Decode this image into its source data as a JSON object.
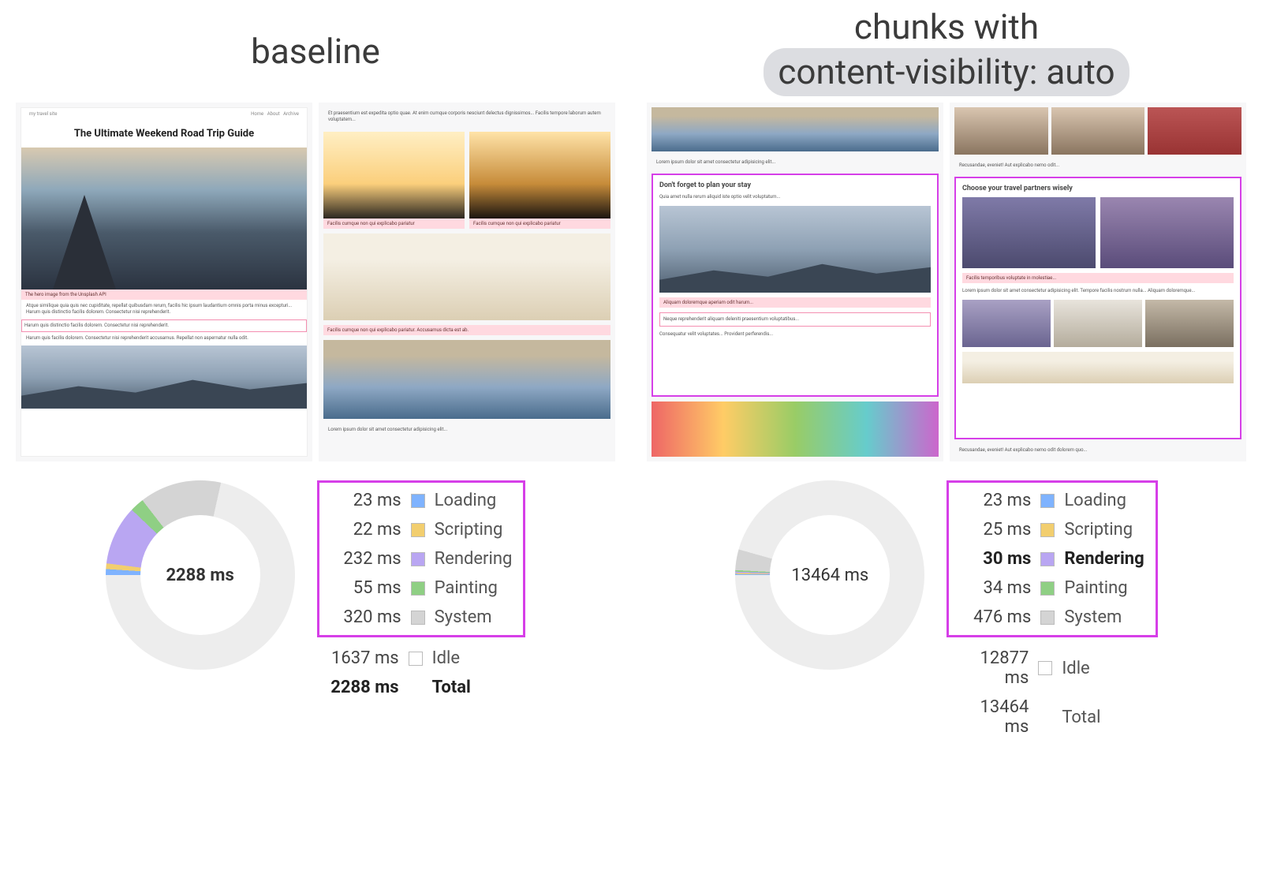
{
  "titles": {
    "left": "baseline",
    "right_line1": "chunks with",
    "right_line2_pill": "content-visibility: auto"
  },
  "mock": {
    "left_page_title": "The Ultimate Weekend Road Trip Guide",
    "section_plan_stay": "Don't forget to plan your stay",
    "section_partners": "Choose your travel partners wisely"
  },
  "legend_labels": {
    "loading": "Loading",
    "scripting": "Scripting",
    "rendering": "Rendering",
    "painting": "Painting",
    "system": "System",
    "idle": "Idle",
    "total": "Total"
  },
  "colors": {
    "loading": "#7fb3ff",
    "scripting": "#f2ce6f",
    "rendering": "#b9a6f2",
    "painting": "#8fcf84",
    "system": "#d4d4d4",
    "idle": "#ffffff",
    "highlight_border": "#d63fe8"
  },
  "left": {
    "total_center": "2288 ms",
    "rows": {
      "loading": "23 ms",
      "scripting": "22 ms",
      "rendering": "232 ms",
      "painting": "55 ms",
      "system": "320 ms",
      "idle": "1637 ms",
      "total": "2288 ms"
    }
  },
  "right": {
    "total_center": "13464 ms",
    "rows": {
      "loading": "23 ms",
      "scripting": "25 ms",
      "rendering": "30 ms",
      "painting": "34 ms",
      "system": "476 ms",
      "idle": "12877 ms",
      "total": "13464 ms"
    }
  },
  "chart_data": [
    {
      "type": "pie",
      "title": "DevTools performance summary — baseline",
      "unit": "ms",
      "series": [
        {
          "name": "Loading",
          "value": 23,
          "color": "#7fb3ff"
        },
        {
          "name": "Scripting",
          "value": 22,
          "color": "#f2ce6f"
        },
        {
          "name": "Rendering",
          "value": 232,
          "color": "#b9a6f2"
        },
        {
          "name": "Painting",
          "value": 55,
          "color": "#8fcf84"
        },
        {
          "name": "System",
          "value": 320,
          "color": "#d4d4d4"
        },
        {
          "name": "Idle",
          "value": 1637,
          "color": "#ffffff"
        }
      ],
      "total": 2288
    },
    {
      "type": "pie",
      "title": "DevTools performance summary — content-visibility: auto",
      "unit": "ms",
      "series": [
        {
          "name": "Loading",
          "value": 23,
          "color": "#7fb3ff"
        },
        {
          "name": "Scripting",
          "value": 25,
          "color": "#f2ce6f"
        },
        {
          "name": "Rendering",
          "value": 30,
          "color": "#b9a6f2"
        },
        {
          "name": "Painting",
          "value": 34,
          "color": "#8fcf84"
        },
        {
          "name": "System",
          "value": 476,
          "color": "#d4d4d4"
        },
        {
          "name": "Idle",
          "value": 12877,
          "color": "#ffffff"
        }
      ],
      "total": 13464
    }
  ]
}
